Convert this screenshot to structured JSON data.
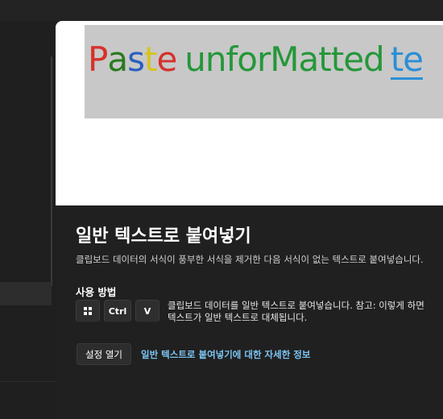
{
  "hero": {
    "banner_letters": [
      {
        "t": "P",
        "c": "#d6312b"
      },
      {
        "t": "a",
        "c": "#2a7a1f"
      },
      {
        "t": "s",
        "c": "#2b5fbf"
      },
      {
        "t": "t",
        "c": "#d8c31c"
      },
      {
        "t": "e",
        "c": "#d6312b"
      }
    ],
    "banner_word2": [
      {
        "t": "unfor",
        "c": "#25973a"
      },
      {
        "t": "M",
        "c": "#25973a"
      },
      {
        "t": "atted",
        "c": "#25973a"
      }
    ],
    "banner_word3": {
      "t": "te",
      "c": "#2b8fd6"
    }
  },
  "main": {
    "title": "일반 텍스트로 붙여넣기",
    "description": "클립보드 데이터의 서식이 풍부한 서식을 제거한 다음 서식이 없는 텍스트로 붙여넣습니다.",
    "howto_heading": "사용 방법",
    "keys": {
      "ctrl": "Ctrl",
      "v": "V"
    },
    "howto_line1": "클립보드 데이터를 일반 텍스트로 붙여넣습니다. 참고: 이렇게 하면",
    "howto_line2": "텍스트가 일반 텍스트로 대체됩니다.",
    "settings_button": "설정 열기",
    "learn_more_link": "일반 텍스트로 붙여넣기에 대한 자세한 정보"
  },
  "colors": {
    "accent_link": "#7cc4f2",
    "background": "#202020"
  }
}
